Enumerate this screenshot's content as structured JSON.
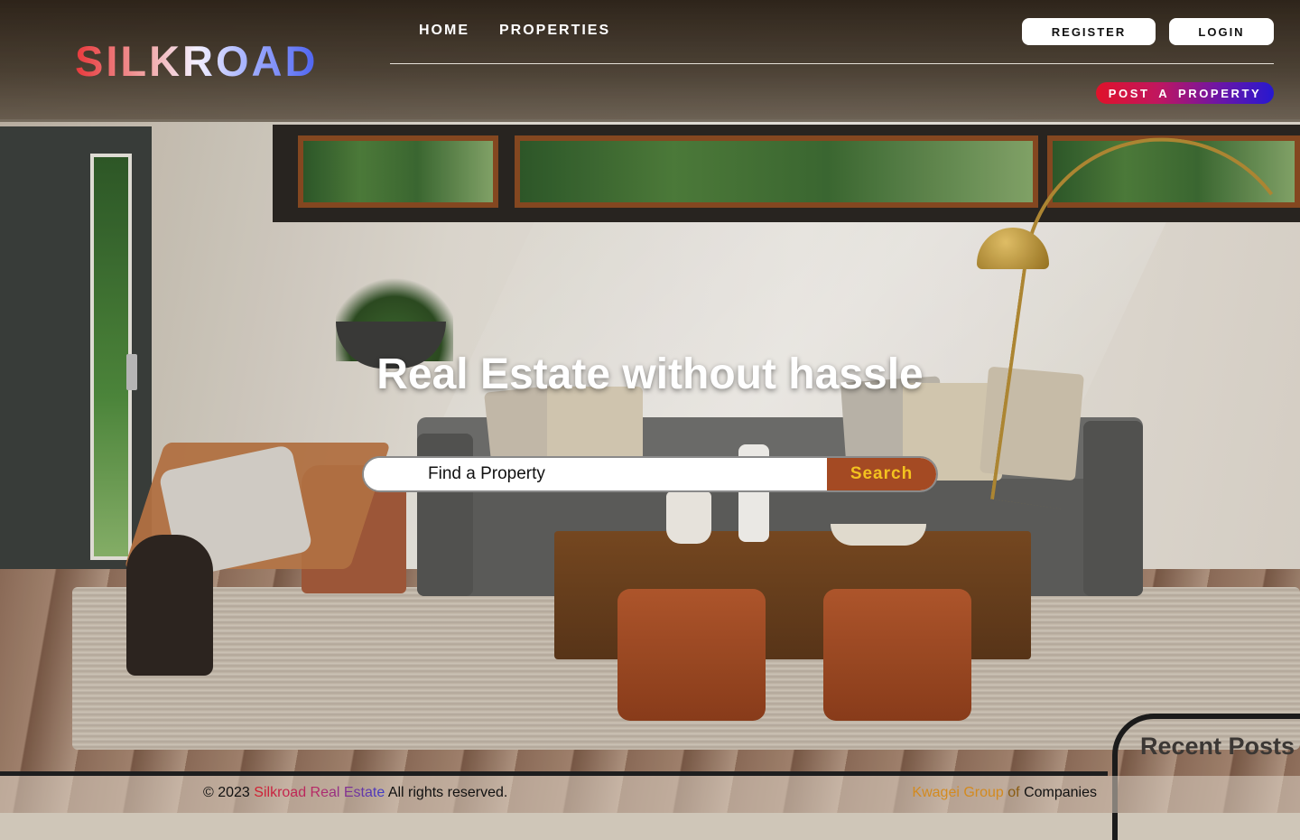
{
  "header": {
    "logo": "SILKROAD",
    "nav": [
      {
        "label": "HOME"
      },
      {
        "label": "PROPERTIES"
      }
    ],
    "register_label": "REGISTER",
    "login_label": "LOGIN",
    "post_property_label": "POST A PROPERTY"
  },
  "hero": {
    "title": "Real Estate without hassle",
    "search": {
      "placeholder": "Find a Property",
      "button_label": "Search"
    }
  },
  "recent_posts": {
    "title": "Recent Posts"
  },
  "footer": {
    "copyright_prefix": "© 2023",
    "brand": "Silkroad Real Estate",
    "copyright_suffix": "All rights reserved.",
    "group_name": "Kwagei Group",
    "group_of": "of",
    "group_suffix": "Companies"
  },
  "colors": {
    "search_button_bg": "#a44a23",
    "search_button_text": "#f3c21f",
    "post_gradient_start": "#e0122a",
    "post_gradient_end": "#2618d0",
    "group_name": "#d38a1f"
  }
}
